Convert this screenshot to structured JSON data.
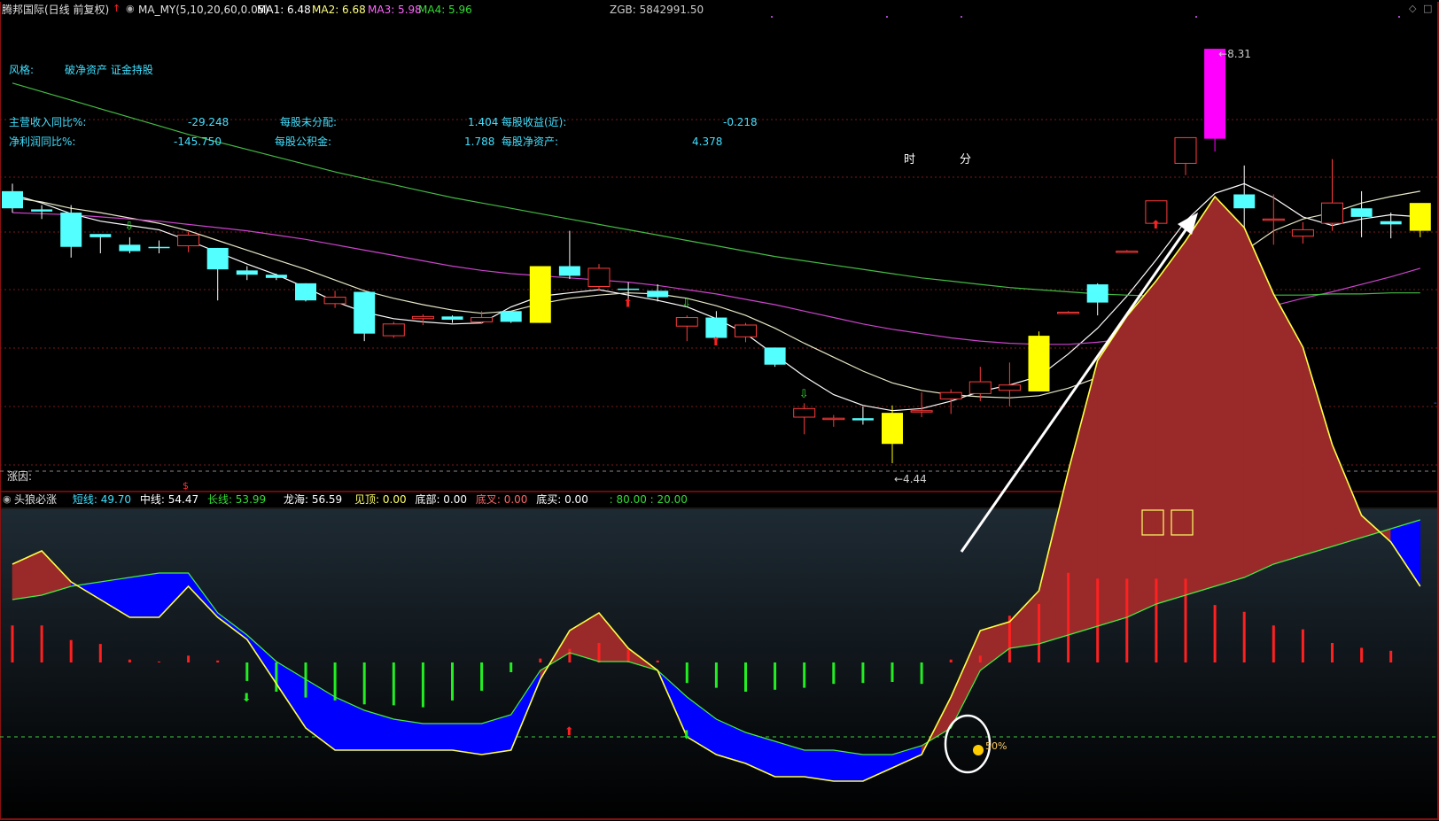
{
  "header": {
    "stock_name": "腾邦国际(日线 前复权)",
    "indicator": "MA_MY(5,10,20,60,0.05)",
    "ma1": "MA1: 6.48",
    "ma2": "MA2: 6.68",
    "ma3": "MA3: 5.98",
    "ma4": "MA4: 5.96",
    "zgb": "ZGB: 5842991.50"
  },
  "info": {
    "style_label": "风格:",
    "style_value": "破净资产 证金持股",
    "r1_label1": "主营收入同比%:",
    "r1_val1": "-29.248",
    "r1_label2": "每股未分配:",
    "r1_val2": "1.404",
    "r1_label3": "每股收益(近):",
    "r1_val3": "-0.218",
    "r2_label1": "净利润同比%:",
    "r2_val1": "-145.750",
    "r2_label2": "每股公积金:",
    "r2_val2": "1.788",
    "r2_label3": "每股净资产:",
    "r2_val3": "4.378",
    "time_label": "时",
    "minute_label": "分",
    "zhangyin": "涨因:"
  },
  "lower_header": {
    "name": "头狼必涨",
    "short": "短线: 49.70",
    "mid": "中线: 54.47",
    "long": "长线: 53.99",
    "longhai": "龙海: 56.59",
    "jianding": "见顶: 0.00",
    "dibu": "底部: 0.00",
    "dicha": "底叉: 0.00",
    "dimai": "底买: 0.00",
    "levels": ": 80.00 : 20.00"
  },
  "colors": {
    "up": "#ff3c3c",
    "down": "#54ffff",
    "bigup_yellow": "#ffff00",
    "bigup_magenta": "#ff00ff",
    "ma1": "#ffffff",
    "ma2": "#e8e8c8",
    "ma3": "#cc44cc",
    "ma4": "#44bb44",
    "label_cyan": "#40e0ff",
    "label_pink": "#ff66ff",
    "label_green": "#33dd33",
    "lower_red_fill": "#9a2a2a",
    "lower_blue_fill": "#0000ff"
  },
  "chart_data": [
    {
      "type": "candlestick",
      "title": "",
      "ylim": [
        4.2,
        8.6
      ],
      "annotations": [
        "8.31",
        "4.44"
      ],
      "candles": [
        {
          "o": 6.98,
          "h": 7.05,
          "l": 6.78,
          "c": 6.82
        },
        {
          "o": 6.81,
          "h": 6.85,
          "l": 6.72,
          "c": 6.79
        },
        {
          "o": 6.78,
          "h": 6.85,
          "l": 6.36,
          "c": 6.46
        },
        {
          "o": 6.58,
          "h": 6.58,
          "l": 6.4,
          "c": 6.55
        },
        {
          "o": 6.48,
          "h": 6.55,
          "l": 6.4,
          "c": 6.42
        },
        {
          "o": 6.46,
          "h": 6.52,
          "l": 6.4,
          "c": 6.45
        },
        {
          "o": 6.47,
          "h": 6.6,
          "l": 6.41,
          "c": 6.57
        },
        {
          "o": 6.45,
          "h": 6.45,
          "l": 5.96,
          "c": 6.25
        },
        {
          "o": 6.24,
          "h": 6.28,
          "l": 6.15,
          "c": 6.2
        },
        {
          "o": 6.2,
          "h": 6.21,
          "l": 6.15,
          "c": 6.17
        },
        {
          "o": 6.12,
          "h": 6.12,
          "l": 5.95,
          "c": 5.96
        },
        {
          "o": 5.93,
          "h": 6.05,
          "l": 5.89,
          "c": 5.99
        },
        {
          "o": 6.04,
          "h": 6.04,
          "l": 5.58,
          "c": 5.65
        },
        {
          "o": 5.63,
          "h": 5.76,
          "l": 5.61,
          "c": 5.74
        },
        {
          "o": 5.79,
          "h": 5.83,
          "l": 5.73,
          "c": 5.81
        },
        {
          "o": 5.81,
          "h": 5.82,
          "l": 5.75,
          "c": 5.78
        },
        {
          "o": 5.76,
          "h": 5.86,
          "l": 5.74,
          "c": 5.8
        },
        {
          "o": 5.86,
          "h": 5.86,
          "l": 5.75,
          "c": 5.76
        },
        {
          "o": 5.75,
          "h": 6.28,
          "l": 5.75,
          "c": 6.28
        },
        {
          "o": 6.28,
          "h": 6.61,
          "l": 6.16,
          "c": 6.19
        },
        {
          "o": 6.09,
          "h": 6.3,
          "l": 6.05,
          "c": 6.26
        },
        {
          "o": 6.07,
          "h": 6.13,
          "l": 5.94,
          "c": 6.06
        },
        {
          "o": 6.05,
          "h": 6.11,
          "l": 5.95,
          "c": 5.99
        },
        {
          "o": 5.72,
          "h": 5.82,
          "l": 5.58,
          "c": 5.8
        },
        {
          "o": 5.8,
          "h": 5.86,
          "l": 5.58,
          "c": 5.61
        },
        {
          "o": 5.62,
          "h": 5.75,
          "l": 5.57,
          "c": 5.73
        },
        {
          "o": 5.52,
          "h": 5.52,
          "l": 5.34,
          "c": 5.36
        },
        {
          "o": 4.87,
          "h": 5.0,
          "l": 4.71,
          "c": 4.95
        },
        {
          "o": 4.85,
          "h": 4.89,
          "l": 4.78,
          "c": 4.86
        },
        {
          "o": 4.86,
          "h": 4.97,
          "l": 4.8,
          "c": 4.84
        },
        {
          "o": 4.62,
          "h": 4.98,
          "l": 4.44,
          "c": 4.91
        },
        {
          "o": 4.92,
          "h": 5.1,
          "l": 4.87,
          "c": 4.93
        },
        {
          "o": 5.04,
          "h": 5.13,
          "l": 4.9,
          "c": 5.1
        },
        {
          "o": 5.09,
          "h": 5.34,
          "l": 5.02,
          "c": 5.2
        },
        {
          "o": 5.12,
          "h": 5.38,
          "l": 4.97,
          "c": 5.17
        },
        {
          "o": 5.11,
          "h": 5.67,
          "l": 5.11,
          "c": 5.63
        },
        {
          "o": 5.85,
          "h": 5.86,
          "l": 5.84,
          "c": 5.85
        },
        {
          "o": 6.11,
          "h": 6.12,
          "l": 5.82,
          "c": 5.94
        },
        {
          "o": 6.42,
          "h": 6.43,
          "l": 6.41,
          "c": 6.42
        },
        {
          "o": 6.68,
          "h": 6.89,
          "l": 6.68,
          "c": 6.89
        },
        {
          "o": 7.24,
          "h": 7.48,
          "l": 7.13,
          "c": 7.48
        },
        {
          "o": 7.47,
          "h": 8.31,
          "l": 7.35,
          "c": 8.31
        },
        {
          "o": 6.95,
          "h": 7.22,
          "l": 6.56,
          "c": 6.82
        },
        {
          "o": 6.72,
          "h": 6.95,
          "l": 6.48,
          "c": 6.72
        },
        {
          "o": 6.56,
          "h": 6.69,
          "l": 6.49,
          "c": 6.62
        },
        {
          "o": 6.68,
          "h": 7.28,
          "l": 6.61,
          "c": 6.87
        },
        {
          "o": 6.82,
          "h": 6.98,
          "l": 6.55,
          "c": 6.74
        },
        {
          "o": 6.7,
          "h": 6.78,
          "l": 6.54,
          "c": 6.67
        },
        {
          "o": 6.61,
          "h": 6.86,
          "l": 6.55,
          "c": 6.87
        }
      ],
      "series": [
        {
          "name": "MA1",
          "values": [
            6.95,
            6.87,
            6.77,
            6.7,
            6.66,
            6.62,
            6.52,
            6.41,
            6.3,
            6.2,
            6.08,
            5.95,
            5.85,
            5.79,
            5.76,
            5.74,
            5.75,
            5.9,
            6.0,
            6.03,
            6.06,
            6.01,
            5.96,
            5.9,
            5.79,
            5.65,
            5.45,
            5.25,
            5.08,
            4.98,
            4.93,
            4.95,
            5.02,
            5.11,
            5.17,
            5.25,
            5.46,
            5.7,
            6.0,
            6.34,
            6.7,
            6.96,
            7.05,
            6.92,
            6.74,
            6.66,
            6.72,
            6.76,
            6.74
          ]
        },
        {
          "name": "MA2",
          "values": [
            6.92,
            6.88,
            6.82,
            6.78,
            6.73,
            6.68,
            6.61,
            6.52,
            6.43,
            6.34,
            6.25,
            6.15,
            6.05,
            5.98,
            5.92,
            5.87,
            5.84,
            5.86,
            5.93,
            5.98,
            6.01,
            6.03,
            6.02,
            5.98,
            5.91,
            5.82,
            5.7,
            5.56,
            5.43,
            5.3,
            5.19,
            5.12,
            5.08,
            5.06,
            5.05,
            5.07,
            5.14,
            5.24,
            5.38,
            5.56,
            5.8,
            6.1,
            6.42,
            6.61,
            6.72,
            6.78,
            6.87,
            6.93,
            6.98
          ]
        },
        {
          "name": "MA3",
          "values": [
            6.78,
            6.77,
            6.76,
            6.74,
            6.72,
            6.7,
            6.67,
            6.64,
            6.61,
            6.57,
            6.53,
            6.48,
            6.43,
            6.38,
            6.33,
            6.28,
            6.24,
            6.21,
            6.19,
            6.17,
            6.15,
            6.13,
            6.1,
            6.06,
            6.02,
            5.97,
            5.92,
            5.86,
            5.8,
            5.74,
            5.69,
            5.65,
            5.61,
            5.58,
            5.56,
            5.55,
            5.55,
            5.57,
            5.6,
            5.64,
            5.7,
            5.77,
            5.84,
            5.91,
            5.98,
            6.04,
            6.11,
            6.18,
            6.26
          ]
        },
        {
          "name": "MA4",
          "values": [
            7.99,
            7.91,
            7.83,
            7.75,
            7.67,
            7.59,
            7.51,
            7.44,
            7.37,
            7.3,
            7.23,
            7.16,
            7.1,
            7.04,
            6.98,
            6.92,
            6.87,
            6.82,
            6.77,
            6.72,
            6.67,
            6.62,
            6.57,
            6.52,
            6.47,
            6.42,
            6.37,
            6.33,
            6.29,
            6.25,
            6.21,
            6.17,
            6.14,
            6.11,
            6.08,
            6.06,
            6.04,
            6.02,
            6.01,
            6.0,
            6.0,
            6.0,
            6.0,
            6.01,
            6.01,
            6.02,
            6.02,
            6.03,
            6.03
          ]
        }
      ]
    },
    {
      "type": "area",
      "title": "头狼必涨",
      "ylim": [
        0,
        100
      ],
      "reference_levels": [
        80,
        20
      ],
      "series": [
        {
          "name": "短线",
          "values": [
            39,
            42,
            35,
            31,
            27,
            27,
            34,
            27,
            22,
            12,
            2,
            -3,
            -3,
            -3,
            -3,
            -3,
            -4,
            -3,
            13,
            24,
            28,
            20,
            15,
            0,
            -4,
            -6,
            -9,
            -9,
            -10,
            -10,
            -7,
            -4,
            9,
            24,
            26,
            33,
            60,
            85,
            95,
            103,
            112,
            122,
            115,
            100,
            88,
            66,
            50,
            44,
            34
          ]
        },
        {
          "name": "长线",
          "values": [
            31,
            32,
            34,
            35,
            36,
            37,
            37,
            28,
            23,
            17,
            13,
            9,
            6,
            4,
            3,
            3,
            3,
            5,
            15,
            19,
            17,
            17,
            15,
            9,
            4,
            1,
            -1,
            -3,
            -3,
            -4,
            -4,
            -2,
            2,
            15,
            20,
            21,
            23,
            25,
            27,
            30,
            32,
            34,
            36,
            39,
            41,
            43,
            45,
            47,
            49
          ]
        },
        {
          "name": "柱线",
          "values": [
            38,
            38,
            23,
            19,
            3,
            1,
            7,
            2,
            -19,
            -30,
            -36,
            -39,
            -43,
            -44,
            -46,
            -39,
            -29,
            -10,
            4,
            14,
            20,
            13,
            2,
            -21,
            -26,
            -30,
            -28,
            -26,
            -22,
            -21,
            -20,
            -22,
            3,
            7,
            48,
            60,
            92,
            86,
            86,
            86,
            86,
            59,
            52,
            38,
            34,
            20,
            15,
            12,
            0
          ]
        }
      ]
    }
  ]
}
